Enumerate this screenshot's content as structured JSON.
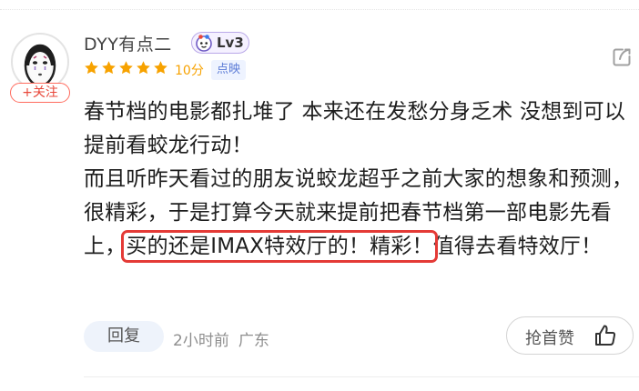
{
  "comment": {
    "user": {
      "name": "DYY有点二",
      "level": "Lv3",
      "follow_label": "+关注",
      "avatar_icon": "no-face-avatar"
    },
    "rating": {
      "stars_filled": 5,
      "stars_total": 5,
      "score_text": "10分",
      "tag": "点映",
      "star_color": "#f7a200"
    },
    "body": {
      "line1": "春节档的电影都扎堆了 本来还在发愁分身乏术 没想到可以提前看蛟龙行动！",
      "line2_before": "而且听昨天看过的朋友说蛟龙超乎之前大家的想象和预测，很精彩，于是打算今天就来提前把春节档第一部电影先看上，",
      "line2_highlight": "买的还是IMAX特效厅的！精彩！",
      "line2_after": "值得去看特效厅！",
      "highlight_color": "#e43a36"
    },
    "footer": {
      "reply_label": "回复",
      "time": "2小时前",
      "location": "广东",
      "like_label": "抢首赞",
      "like_icon": "thumbs-up-icon"
    },
    "share_icon": "share-icon"
  }
}
